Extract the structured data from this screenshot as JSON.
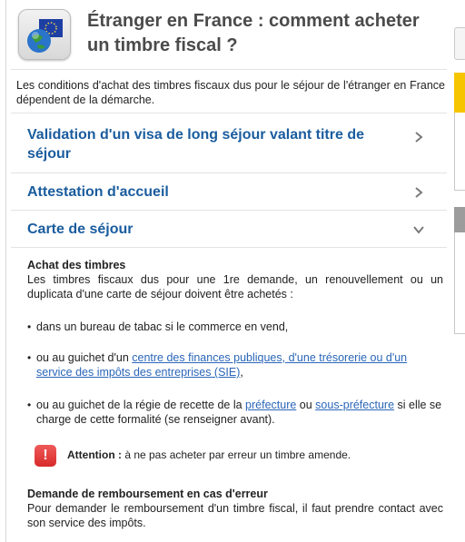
{
  "header": {
    "title": "Étranger en France : comment acheter un timbre fiscal ?"
  },
  "intro": "Les conditions d'achat des timbres fiscaux dus pour le séjour de l'étranger en France dépendent de la démarche.",
  "accordion": [
    {
      "title": "Validation d'un visa de long séjour valant titre de séjour",
      "state": "collapsed",
      "icon": "chevron-right-icon"
    },
    {
      "title": "Attestation d'accueil",
      "state": "collapsed",
      "icon": "chevron-right-icon"
    },
    {
      "title": "Carte de séjour",
      "state": "expanded",
      "icon": "chevron-down-icon"
    }
  ],
  "carte": {
    "achat_heading": "Achat des timbres",
    "achat_text": "Les timbres fiscaux dus pour une 1re demande, un renouvellement ou un duplicata d'une carte de séjour doivent être achetés :",
    "bullet1": "dans un bureau de tabac si le commerce en vend,",
    "bullet2_prefix": "ou au guichet d'un ",
    "bullet2_link": "centre des finances publiques, d'une trésorerie ou d'un service des impôts des entreprises (SIE)",
    "bullet2_suffix": ",",
    "bullet3_prefix": "ou au guichet de la régie de recette de la ",
    "bullet3_link1": "préfecture",
    "bullet3_mid": " ou ",
    "bullet3_link2": "sous-préfecture",
    "bullet3_suffix": " si elle se charge de cette formalité (se renseigner avant).",
    "notice_label": "Attention :",
    "notice_text": " à ne pas acheter par erreur un timbre amende.",
    "notice_icon": "!",
    "remb_heading": "Demande de remboursement en cas d'erreur",
    "remb_text": "Pour demander le remboursement d'un timbre fiscal, il faut prendre contact avec son service des impôts."
  },
  "colors": {
    "accordion_title": "#1a5c9e",
    "link": "#2a66b8",
    "warning": "#e03c3c",
    "sidebar_yellow": "#f6c500"
  }
}
